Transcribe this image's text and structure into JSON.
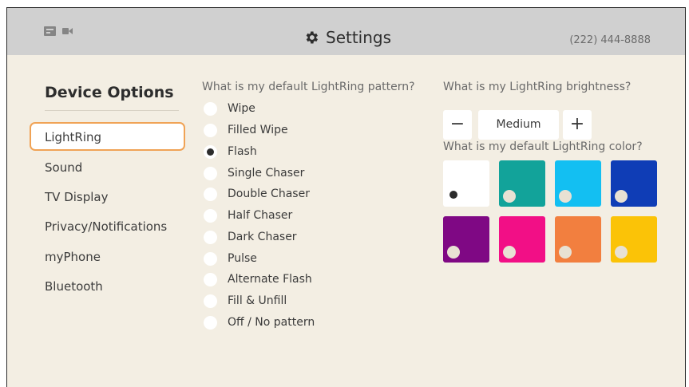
{
  "header": {
    "title": "Settings",
    "phone": "(222) 444-8888",
    "icons": [
      "router-icon",
      "camera-icon",
      "gear-icon"
    ]
  },
  "sidebar": {
    "title": "Device Options",
    "items": [
      {
        "label": "LightRing",
        "selected": true
      },
      {
        "label": "Sound"
      },
      {
        "label": "TV Display"
      },
      {
        "label": "Privacy/Notifications"
      },
      {
        "label": "myPhone"
      },
      {
        "label": "Bluetooth"
      }
    ]
  },
  "pattern": {
    "question": "What is my default LightRing pattern?",
    "selected": "Flash",
    "options": [
      "Wipe",
      "Filled Wipe",
      "Flash",
      "Single Chaser",
      "Double Chaser",
      "Half Chaser",
      "Dark Chaser",
      "Pulse",
      "Alternate Flash",
      "Fill & Unfill",
      "Off / No pattern"
    ]
  },
  "brightness": {
    "question": "What is my LightRing brightness?",
    "decrease_label": "−",
    "value": "Medium",
    "increase_label": "+"
  },
  "color": {
    "question": "What is my default LightRing color?",
    "selected_index": 0,
    "swatches": [
      "#ffffff",
      "#12a39a",
      "#13bff2",
      "#0f3db6",
      "#7f0884",
      "#f20f86",
      "#f27f3f",
      "#fbc307"
    ]
  }
}
